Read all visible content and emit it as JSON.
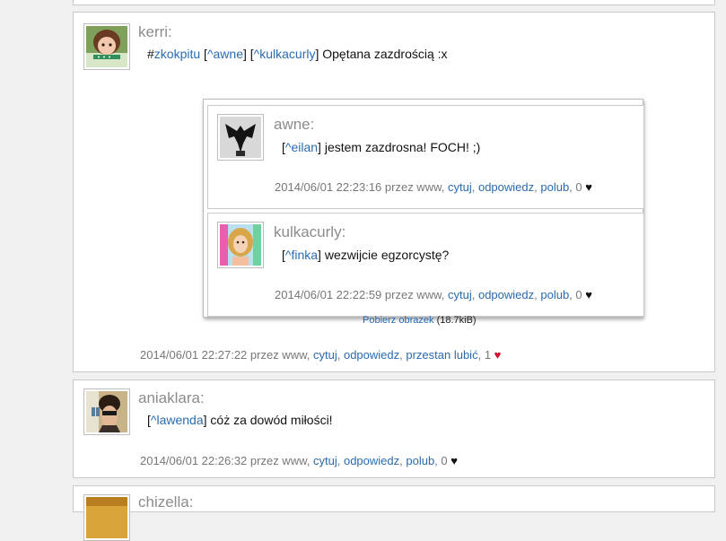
{
  "posts": [
    {
      "username": "kerri:",
      "hashtag_hash": "#",
      "hashtag": "zkokpitu",
      "mention1": "^awne",
      "mention2": "^kulkacurly",
      "text": "Opętana zazdrością :x",
      "quotes": [
        {
          "username": "awne:",
          "mention": "^eilan",
          "text": "jestem zazdrosna! FOCH! ;)",
          "meta": {
            "timestamp": "2014/06/01 22:23:16",
            "via": "przez www,",
            "cytuj": "cytuj",
            "odpowiedz": "odpowiedz",
            "like": "polub",
            "count": "0",
            "heart": "♥"
          }
        },
        {
          "username": "kulkacurly:",
          "mention": "^finka",
          "text": "wezwijcie egzorcystę?",
          "meta": {
            "timestamp": "2014/06/01 22:22:59",
            "via": "przez www,",
            "cytuj": "cytuj",
            "odpowiedz": "odpowiedz",
            "like": "polub",
            "count": "0",
            "heart": "♥"
          }
        }
      ],
      "download_link": "Pobierz obrazek",
      "download_size": "(18.7kiB)",
      "meta": {
        "timestamp": "2014/06/01 22:27:22",
        "via": "przez www,",
        "cytuj": "cytuj",
        "odpowiedz": "odpowiedz",
        "like": "przestan lubić",
        "count": "1",
        "heart": "♥"
      }
    },
    {
      "username": "aniaklara:",
      "mention": "^lawenda",
      "text": "cóż za dowód miłości!",
      "meta": {
        "timestamp": "2014/06/01 22:26:32",
        "via": "przez www,",
        "cytuj": "cytuj",
        "odpowiedz": "odpowiedz",
        "like": "polub",
        "count": "0",
        "heart": "♥"
      }
    },
    {
      "username": "chizella:"
    }
  ],
  "colors": {
    "link": "#2a6bb0",
    "username": "#8c8c8c",
    "meta": "#777777",
    "heart_liked": "#d0112b",
    "heart_default": "#111111"
  }
}
